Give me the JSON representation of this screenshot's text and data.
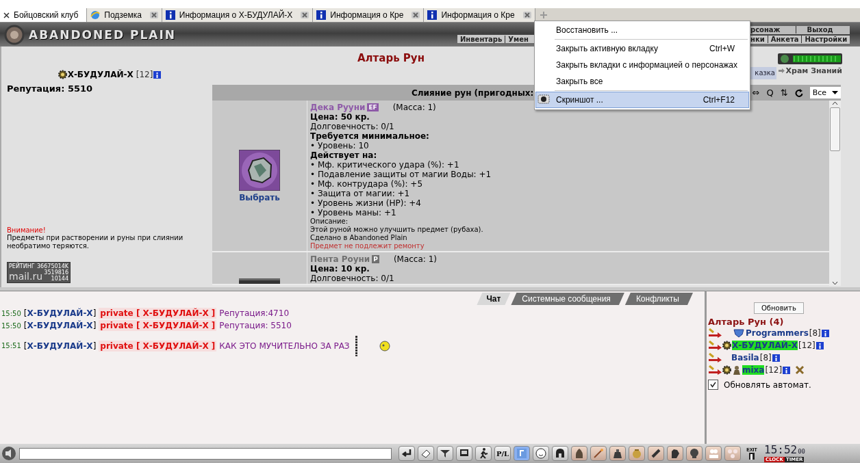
{
  "browser_tabs": [
    {
      "label": "Бойцовский клуб",
      "selected": true,
      "kind": "close"
    },
    {
      "label": "Подземка",
      "selected": false,
      "kind": "globe"
    },
    {
      "label": "Информация о Х-БУДУЛАЙ-Х",
      "selected": false,
      "kind": "info"
    },
    {
      "label": "Информация о Кре",
      "selected": false,
      "kind": "info"
    },
    {
      "label": "Информация о Кре",
      "selected": false,
      "kind": "info"
    }
  ],
  "header": {
    "logo": "ABANDONED PLAIN",
    "nav_left": [
      "Инвентарь",
      "Умен"
    ],
    "nav_right_top": [
      "рсонаж",
      "Выход"
    ],
    "nav_right_bottom": [
      "нки",
      "Анкета",
      "Настройки"
    ]
  },
  "context_menu": {
    "items": [
      {
        "label": "Восстановить ...",
        "selected": false,
        "separator_before": false
      },
      {
        "label": "Закрыть активную вкладку",
        "shortcut": "Ctrl+W",
        "selected": false,
        "separator_before": true
      },
      {
        "label": "Закрыть вкладки  с информацией о персонажах",
        "selected": false,
        "separator_before": false
      },
      {
        "label": "Закрыть все",
        "selected": false,
        "separator_before": false
      },
      {
        "label": "Скриншот ...",
        "shortcut": "Ctrl+F12",
        "selected": true,
        "separator_before": true,
        "kind": "camera"
      }
    ]
  },
  "player": {
    "name": "Х-БУДУЛАЙ-Х",
    "rank": "[12]"
  },
  "reputation": "Репутация: 5510",
  "warning": {
    "title": "Внимание!",
    "text": "Предметы при растворении и руны при слиянии необратимо теряются."
  },
  "counter": {
    "label": "РЕЙТИНГ",
    "total": "36675014K",
    "brand": "mail.ru",
    "hits": "3519816",
    "hosts": "10144"
  },
  "page_title": "Алтарь Рун",
  "hint_tab": "казка",
  "temple_link": "Храм Знаний",
  "table": {
    "title": "Слияние рун (пригодных:",
    "tools": [
      "⇔",
      "Q",
      "⇅"
    ],
    "filter": "Все",
    "items": [
      {
        "name": "Дека Рууни",
        "badge": "EF",
        "color": "#8e5aa8",
        "mass": "(Масса: 1)",
        "action": "Выбрать",
        "lines": [
          {
            "kind": "bold",
            "text": "Цена: 50 кр."
          },
          {
            "kind": "normal",
            "text": "Долговечность: 0/1"
          },
          {
            "kind": "bold",
            "text": "Требуется минимальное:"
          },
          {
            "kind": "normal",
            "text": "• Уровень: 10"
          },
          {
            "kind": "bold",
            "text": "Действует на:"
          },
          {
            "kind": "normal",
            "text": "• Мф. критического удара (%): +1"
          },
          {
            "kind": "normal",
            "text": "• Подавление защиты от магии Воды: +1"
          },
          {
            "kind": "normal",
            "text": "• Мф. контрудара (%): +5"
          },
          {
            "kind": "normal",
            "text": "• Защита от магии: +1"
          },
          {
            "kind": "normal",
            "text": "• Уровень жизни (HP): +4"
          },
          {
            "kind": "normal",
            "text": "• Уровень маны: +1"
          },
          {
            "kind": "small",
            "text": "Описание:"
          },
          {
            "kind": "small",
            "text": "Этой руной можно улучшить предмет (рубаха)."
          },
          {
            "kind": "small",
            "text": "Сделано в Abandoned Plain"
          },
          {
            "kind": "warn",
            "text": "Предмет не подлежит ремонту"
          }
        ]
      },
      {
        "name": "Пента Роуни",
        "badge": "P",
        "color": "#707070",
        "mass": "(Масса: 1)",
        "lines": [
          {
            "kind": "bold",
            "text": "Цена: 10 кр."
          },
          {
            "kind": "normal",
            "text": "Долговечность: 0/1"
          }
        ]
      }
    ]
  },
  "chat": {
    "tabs": [
      {
        "label": "Чат",
        "selected": true
      },
      {
        "label": "Системные сообщения",
        "selected": false
      },
      {
        "label": "Конфликты",
        "selected": false
      }
    ],
    "messages": [
      {
        "time": "15:50",
        "sender": "[**Х-БУДУЛАЙ-Х**]",
        "to": "private [ Х-БУДУЛАЙ-Х ]",
        "text": "Репутация:4710"
      },
      {
        "time": "15:50",
        "sender": "[**Х-БУДУЛАЙ-Х**]",
        "to": "private [ Х-БУДУЛАЙ-Х ]",
        "text": "Репутация:  5510"
      },
      {
        "time": "15:51",
        "sender": "[**Х-БУДУЛАЙ-Х**]",
        "to": "private [ Х-БУДУЛАЙ-Х ]",
        "text": "КАК ЭТО МУЧИТЕЛЬНО ЗА РАЗ"
      }
    ]
  },
  "who": {
    "refresh": "Обновить",
    "title": "Алтарь Рун (4)",
    "users": [
      {
        "name": "Programmers",
        "rank": "[8]",
        "highlighted": false,
        "kind": "clan",
        "fight": false
      },
      {
        "name": "Х-БУДУЛАЙ-Х",
        "rank": "[12]",
        "highlighted": true,
        "kind": "gear",
        "fight": false
      },
      {
        "name": "Basila",
        "rank": "[8]",
        "highlighted": false,
        "kind": "none",
        "fight": false
      },
      {
        "name": "mixa",
        "rank": "[12]",
        "highlighted": true,
        "kind": "gear_figure",
        "fight": true
      }
    ],
    "auto_refresh": {
      "label": "Обновлять автомат.",
      "checked": true
    }
  },
  "toolbar": {
    "pl": "P/L",
    "exit": "EXIT",
    "clock": "15:52",
    "seconds": "00",
    "clock_label": "CLOCK",
    "timer_label": "TIMER"
  }
}
